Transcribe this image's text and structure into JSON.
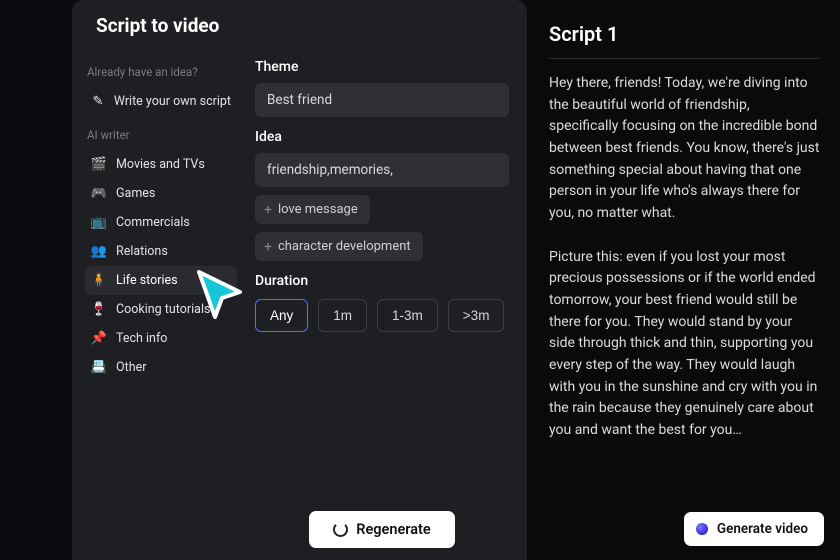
{
  "header": {
    "title": "Script to video"
  },
  "sidebar": {
    "section_idea": "Already have an idea?",
    "write_script": "Write your own script",
    "section_ai": "AI writer",
    "categories": [
      {
        "label": "Movies and TVs",
        "icon": "🎬"
      },
      {
        "label": "Games",
        "icon": "🎮"
      },
      {
        "label": "Commercials",
        "icon": "📺"
      },
      {
        "label": "Relations",
        "icon": "👥"
      },
      {
        "label": "Life stories",
        "icon": "🧍",
        "selected": true
      },
      {
        "label": "Cooking tutorials",
        "icon": "🍷"
      },
      {
        "label": "Tech info",
        "icon": "📌"
      },
      {
        "label": "Other",
        "icon": "📇"
      }
    ]
  },
  "editor": {
    "theme": {
      "label": "Theme",
      "value": "Best friend"
    },
    "idea": {
      "label": "Idea",
      "value": "friendship,memories,",
      "suggestions": [
        "love message",
        "character development"
      ]
    },
    "duration": {
      "label": "Duration",
      "options": [
        "Any",
        "1m",
        "1-3m",
        ">3m"
      ],
      "selected": "Any"
    },
    "regenerate": "Regenerate"
  },
  "script": {
    "title": "Script 1",
    "body": "Hey there, friends! Today, we're diving into the beautiful world of friendship, specifically focusing on the incredible bond between best friends. You know, there's just something special about having that one person in your life who's always there for you, no matter what.\n\nPicture this: even if you lost your most precious possessions or if the world ended tomorrow, your best friend would still be there for you. They would stand by your side through thick and thin, supporting you every step of the way. They would laugh with you in the sunshine and cry with you in the rain because they genuinely care about you and want the best for you…",
    "generate": "Generate video"
  }
}
